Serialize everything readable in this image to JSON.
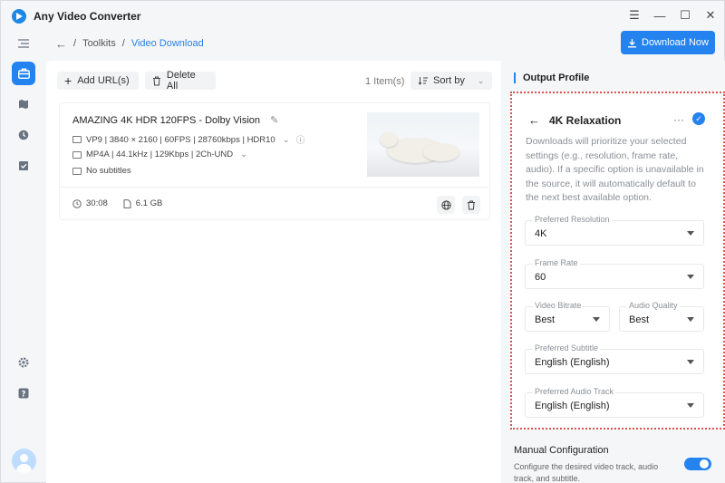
{
  "app": {
    "title": "Any Video Converter"
  },
  "window_controls": {
    "menu": "☰",
    "minimize": "—",
    "maximize": "☐",
    "close": "✕"
  },
  "breadcrumb": {
    "parent": "Toolkits",
    "separator": "/",
    "current": "Video Download"
  },
  "header": {
    "download_now": "Download Now"
  },
  "toolbar": {
    "add_url": "Add URL(s)",
    "delete_all": "Delete All",
    "item_count": "1 Item(s)",
    "sort_by": "Sort by"
  },
  "video": {
    "title": "AMAZING 4K HDR 120FPS - Dolby Vision",
    "video_stream": "VP9 | 3840 × 2160 | 60FPS | 28760kbps | HDR10",
    "audio_stream": "MP4A | 44.1kHz | 129Kbps | 2Ch-UND",
    "subtitles": "No subtitles",
    "duration": "30:08",
    "size": "6.1 GB"
  },
  "output_profile": {
    "section_title": "Output Profile",
    "profile_name": "4K Relaxation",
    "more": "···",
    "description": "Downloads will prioritize your selected settings (e.g., resolution, frame rate, audio). If a specific option is unavailable in the source, it will automatically default to the next best available option.",
    "fields": {
      "resolution": {
        "label": "Preferred Resolution",
        "value": "4K"
      },
      "frame_rate": {
        "label": "Frame Rate",
        "value": "60"
      },
      "video_bitrate": {
        "label": "Video Bitrate",
        "value": "Best"
      },
      "audio_quality": {
        "label": "Audio Quality",
        "value": "Best"
      },
      "subtitle": {
        "label": "Preferred Subtitle",
        "value": "English (English)"
      },
      "audio_track": {
        "label": "Preferred Audio Track",
        "value": "English (English)"
      }
    }
  },
  "manual": {
    "title": "Manual Configuration",
    "description": "Configure the desired video track, audio track, and subtitle.",
    "enabled": true
  },
  "colors": {
    "accent": "#2483ee",
    "highlight_border": "#d9534f"
  },
  "icons": {
    "sidebar": [
      "menu-icon",
      "toolkit-icon",
      "library-icon",
      "history-icon",
      "tasks-icon",
      "settings-icon",
      "help-icon",
      "avatar"
    ]
  }
}
